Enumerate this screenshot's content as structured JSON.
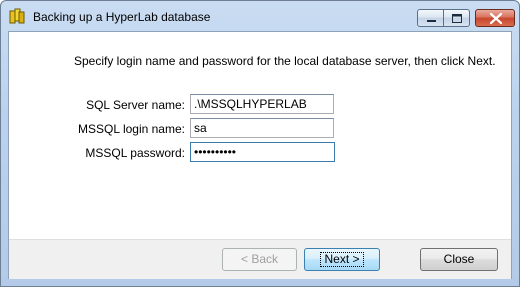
{
  "window": {
    "title": "Backing up a HyperLab database"
  },
  "instruction": "Specify login name and password for the local database server, then click Next.",
  "form": {
    "server_label": "SQL Server name:",
    "server_value": ".\\MSSQLHYPERLAB",
    "login_label": "MSSQL login name:",
    "login_value": "sa",
    "password_label": "MSSQL password:",
    "password_value": "••••••••••"
  },
  "buttons": {
    "back": "< Back",
    "next": "Next >",
    "close": "Close"
  },
  "colors": {
    "titlebar": "#bcd2ec",
    "close_button": "#c8452e",
    "default_button_border": "#3c7fb1",
    "footer_bg": "#f0f0f0"
  },
  "icons": [
    "app-icon",
    "minimize-icon",
    "maximize-icon",
    "close-icon"
  ]
}
